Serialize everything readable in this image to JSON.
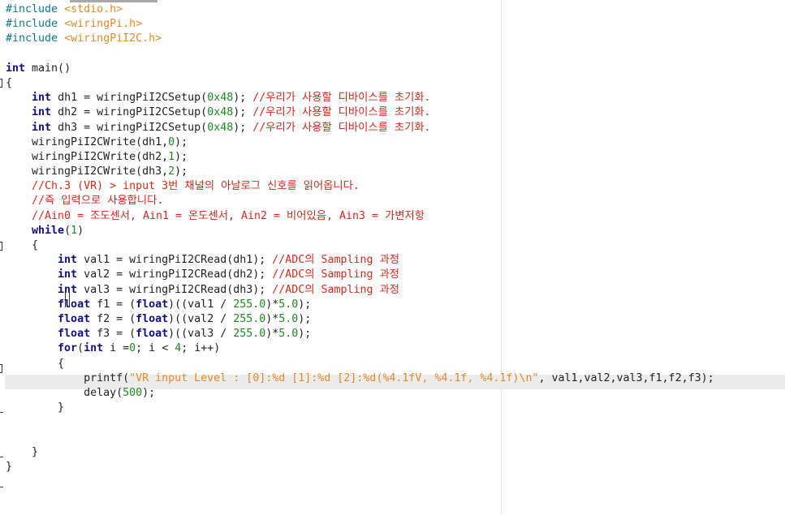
{
  "colors": {
    "keyword": "#101080",
    "preprocessor": "#12798a",
    "header": "#e08a2c",
    "number": "#1e8a1e",
    "string": "#e08a2c",
    "comment": "#d7291b",
    "text": "#222222",
    "current_line_bg": "#ececec"
  },
  "code_lines": [
    [
      {
        "t": "pp",
        "v": "#include "
      },
      {
        "t": "hdr",
        "v": "<stdio.h>"
      }
    ],
    [
      {
        "t": "pp",
        "v": "#include "
      },
      {
        "t": "hdr",
        "v": "<wiringPi.h>"
      }
    ],
    [
      {
        "t": "pp",
        "v": "#include "
      },
      {
        "t": "hdr",
        "v": "<wiringPiI2C.h>"
      }
    ],
    [],
    [
      {
        "t": "kw",
        "v": "int"
      },
      {
        "t": "txt",
        "v": " main()"
      }
    ],
    [
      {
        "t": "txt",
        "v": "{"
      }
    ],
    [
      {
        "t": "txt",
        "v": "    "
      },
      {
        "t": "kw",
        "v": "int"
      },
      {
        "t": "txt",
        "v": " dh1 = wiringPiI2CSetup("
      },
      {
        "t": "num",
        "v": "0x48"
      },
      {
        "t": "txt",
        "v": "); "
      },
      {
        "t": "cmt",
        "v": "//우리가 사용할 디바이스를 초기화."
      }
    ],
    [
      {
        "t": "txt",
        "v": "    "
      },
      {
        "t": "kw",
        "v": "int"
      },
      {
        "t": "txt",
        "v": " dh2 = wiringPiI2CSetup("
      },
      {
        "t": "num",
        "v": "0x48"
      },
      {
        "t": "txt",
        "v": "); "
      },
      {
        "t": "cmt",
        "v": "//우리가 사용할 디바이스를 초기화."
      }
    ],
    [
      {
        "t": "txt",
        "v": "    "
      },
      {
        "t": "kw",
        "v": "int"
      },
      {
        "t": "txt",
        "v": " dh3 = wiringPiI2CSetup("
      },
      {
        "t": "num",
        "v": "0x48"
      },
      {
        "t": "txt",
        "v": "); "
      },
      {
        "t": "cmt",
        "v": "//우리가 사용할 디바이스를 초기화."
      }
    ],
    [
      {
        "t": "txt",
        "v": "    wiringPiI2CWrite(dh1,"
      },
      {
        "t": "num",
        "v": "0"
      },
      {
        "t": "txt",
        "v": ");"
      }
    ],
    [
      {
        "t": "txt",
        "v": "    wiringPiI2CWrite(dh2,"
      },
      {
        "t": "num",
        "v": "1"
      },
      {
        "t": "txt",
        "v": ");"
      }
    ],
    [
      {
        "t": "txt",
        "v": "    wiringPiI2CWrite(dh3,"
      },
      {
        "t": "num",
        "v": "2"
      },
      {
        "t": "txt",
        "v": ");"
      }
    ],
    [
      {
        "t": "txt",
        "v": "    "
      },
      {
        "t": "cmt",
        "v": "//Ch.3 (VR) > input 3번 채널의 아날로그 신호를 읽어옵니다."
      }
    ],
    [
      {
        "t": "txt",
        "v": "    "
      },
      {
        "t": "cmt",
        "v": "//즉 입력으로 사용합니다."
      }
    ],
    [
      {
        "t": "txt",
        "v": "    "
      },
      {
        "t": "cmt",
        "v": "//Ain0 = 조도센서, Ain1 = 온도센서, Ain2 = 비어있음, Ain3 = 가변저항"
      }
    ],
    [
      {
        "t": "txt",
        "v": "    "
      },
      {
        "t": "kw",
        "v": "while"
      },
      {
        "t": "txt",
        "v": "("
      },
      {
        "t": "num",
        "v": "1"
      },
      {
        "t": "txt",
        "v": ")"
      }
    ],
    [
      {
        "t": "txt",
        "v": "    {"
      }
    ],
    [
      {
        "t": "txt",
        "v": "        "
      },
      {
        "t": "kw",
        "v": "int"
      },
      {
        "t": "txt",
        "v": " val1 = wiringPiI2CRead(dh1); "
      },
      {
        "t": "cmt",
        "v": "//ADC의 Sampling 과정"
      }
    ],
    [
      {
        "t": "txt",
        "v": "        "
      },
      {
        "t": "kw",
        "v": "int"
      },
      {
        "t": "txt",
        "v": " val2 = wiringPiI2CRead(dh2); "
      },
      {
        "t": "cmt",
        "v": "//ADC의 Sampling 과정"
      }
    ],
    [
      {
        "t": "txt",
        "v": "        "
      },
      {
        "t": "kw",
        "v": "int"
      },
      {
        "t": "txt",
        "v": " val3 = wiringPiI2CRead(dh3); "
      },
      {
        "t": "cmt",
        "v": "//ADC의 Sampling 과정"
      }
    ],
    [
      {
        "t": "txt",
        "v": "        "
      },
      {
        "t": "kw",
        "v": "float"
      },
      {
        "t": "txt",
        "v": " f1 = ("
      },
      {
        "t": "kw",
        "v": "float"
      },
      {
        "t": "txt",
        "v": ")((val1 / "
      },
      {
        "t": "num",
        "v": "255.0"
      },
      {
        "t": "txt",
        "v": ")*"
      },
      {
        "t": "num",
        "v": "5.0"
      },
      {
        "t": "txt",
        "v": ");"
      }
    ],
    [
      {
        "t": "txt",
        "v": "        "
      },
      {
        "t": "kw",
        "v": "float"
      },
      {
        "t": "txt",
        "v": " f2 = ("
      },
      {
        "t": "kw",
        "v": "float"
      },
      {
        "t": "txt",
        "v": ")((val2 / "
      },
      {
        "t": "num",
        "v": "255.0"
      },
      {
        "t": "txt",
        "v": ")*"
      },
      {
        "t": "num",
        "v": "5.0"
      },
      {
        "t": "txt",
        "v": ");"
      }
    ],
    [
      {
        "t": "txt",
        "v": "        "
      },
      {
        "t": "kw",
        "v": "float"
      },
      {
        "t": "txt",
        "v": " f3 = ("
      },
      {
        "t": "kw",
        "v": "float"
      },
      {
        "t": "txt",
        "v": ")((val3 / "
      },
      {
        "t": "num",
        "v": "255.0"
      },
      {
        "t": "txt",
        "v": ")*"
      },
      {
        "t": "num",
        "v": "5.0"
      },
      {
        "t": "txt",
        "v": ");"
      }
    ],
    [
      {
        "t": "txt",
        "v": "        "
      },
      {
        "t": "kw",
        "v": "for"
      },
      {
        "t": "txt",
        "v": "("
      },
      {
        "t": "kw",
        "v": "int"
      },
      {
        "t": "txt",
        "v": " i ="
      },
      {
        "t": "num",
        "v": "0"
      },
      {
        "t": "txt",
        "v": "; i < "
      },
      {
        "t": "num",
        "v": "4"
      },
      {
        "t": "txt",
        "v": "; i++)"
      }
    ],
    [
      {
        "t": "txt",
        "v": "        {"
      }
    ],
    [
      {
        "t": "txt",
        "v": "            printf("
      },
      {
        "t": "str",
        "v": "\"VR input Level : [0]:%d [1]:%d [2]:%d(%4.1fV, %4.1f, %4.1f)\\n\""
      },
      {
        "t": "txt",
        "v": ", val1,val2,val3,f1,f2,f3);"
      }
    ],
    [
      {
        "t": "txt",
        "v": "            delay("
      },
      {
        "t": "num",
        "v": "500"
      },
      {
        "t": "txt",
        "v": ");"
      }
    ],
    [
      {
        "t": "txt",
        "v": "        }"
      }
    ],
    [],
    [],
    [
      {
        "t": "txt",
        "v": "    }"
      }
    ],
    [
      {
        "t": "txt",
        "v": "}"
      }
    ]
  ]
}
